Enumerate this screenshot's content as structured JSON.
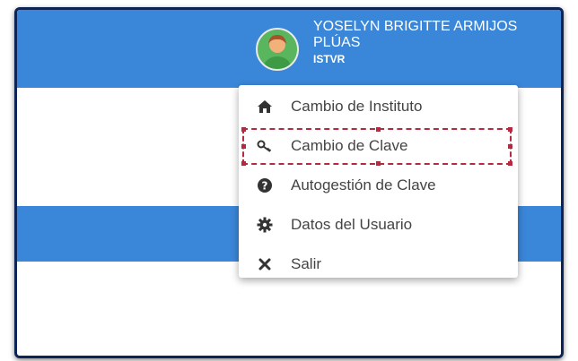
{
  "user": {
    "name_line1": "YOSELYN BRIGITTE ARMIJOS",
    "name_line2": "PLÚAS",
    "institute": "ISTVR"
  },
  "menu": {
    "items": [
      {
        "label": "Cambio de Instituto",
        "icon": "home-icon",
        "glyph": "🏠"
      },
      {
        "label": "Cambio de Clave",
        "icon": "key-icon",
        "glyph": "🔑"
      },
      {
        "label": "Autogestión de Clave",
        "icon": "question-circle-icon",
        "glyph": "?"
      },
      {
        "label": "Datos del Usuario",
        "icon": "gear-icon",
        "glyph": "⚙"
      },
      {
        "label": "Salir",
        "icon": "close-icon",
        "glyph": "✖"
      }
    ]
  },
  "colors": {
    "topbar": "#3a87d9",
    "highlight": "#b32b40",
    "frame": "#0d2456"
  }
}
